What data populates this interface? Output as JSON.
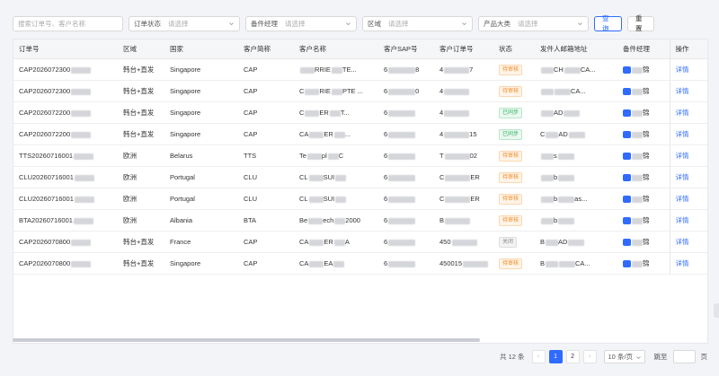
{
  "filters": {
    "search_placeholder": "搜索订单号、客户名称",
    "selects": [
      {
        "label": "订单状态",
        "placeholder": "请选择"
      },
      {
        "label": "备件经理",
        "placeholder": "请选择"
      },
      {
        "label": "区域",
        "placeholder": "请选择"
      },
      {
        "label": "产品大类",
        "placeholder": "请选择"
      }
    ],
    "query_label": "查询",
    "reset_label": "重置"
  },
  "table": {
    "columns": [
      "订单号",
      "区域",
      "国家",
      "客户简称",
      "客户名称",
      "客户SAP号",
      "客户订单号",
      "状态",
      "发件人邮箱地址",
      "备件经理",
      "操作"
    ],
    "rows": [
      {
        "order": "CAP2026072300",
        "region": "韩台+直发",
        "country": "Singapore",
        "abbr": "CAP",
        "name_a": "",
        "name_b": "RRIE",
        "name_c": "TE...",
        "sap_a": "6",
        "sap_b": "8",
        "cust_a": "4",
        "cust_b": "7",
        "status": "待审核",
        "email_a": "",
        "email_b": "CH",
        "email_c": "CA...",
        "mgr": "锦",
        "action": "详情"
      },
      {
        "order": "CAP2026072300",
        "region": "韩台+直发",
        "country": "Singapore",
        "abbr": "CAP",
        "name_a": "C",
        "name_b": "RIE",
        "name_c": "PTE ...",
        "sap_a": "6",
        "sap_b": "0",
        "cust_a": "4",
        "cust_b": "",
        "status": "待审核",
        "email_a": "",
        "email_b": "",
        "email_c": "CA...",
        "mgr": "锦",
        "action": "详情"
      },
      {
        "order": "CAP2026072200",
        "region": "韩台+直发",
        "country": "Singapore",
        "abbr": "CAP",
        "name_a": "C",
        "name_b": "ER",
        "name_c": "T...",
        "sap_a": "6",
        "sap_b": "",
        "cust_a": "4",
        "cust_b": "",
        "status": "已同步",
        "email_a": "",
        "email_b": "AD",
        "email_c": "",
        "mgr": "锦",
        "action": "详情"
      },
      {
        "order": "CAP2026072200",
        "region": "韩台+直发",
        "country": "Singapore",
        "abbr": "CAP",
        "name_a": "CA",
        "name_b": "ER",
        "name_c": "...",
        "sap_a": "6",
        "sap_b": "",
        "cust_a": "4",
        "cust_b": "15",
        "status": "已同步",
        "email_a": "C",
        "email_b": "AD",
        "email_c": "",
        "mgr": "锦",
        "action": "详情"
      },
      {
        "order": "TTS20260716001",
        "region": "欧洲",
        "country": "Belarus",
        "abbr": "TTS",
        "name_a": "Te",
        "name_b": "pl",
        "name_c": "C",
        "sap_a": "6",
        "sap_b": "",
        "cust_a": "T",
        "cust_b": "02",
        "status": "待审核",
        "email_a": "",
        "email_b": "s",
        "email_c": "",
        "mgr": "锦",
        "action": "详情"
      },
      {
        "order": "CLU20260716001",
        "region": "欧洲",
        "country": "Portugal",
        "abbr": "CLU",
        "name_a": "CL",
        "name_b": "SUI",
        "name_c": "",
        "sap_a": "6",
        "sap_b": "",
        "cust_a": "C",
        "cust_b": "ER",
        "status": "待审核",
        "email_a": "",
        "email_b": "b",
        "email_c": "",
        "mgr": "锦",
        "action": "详情"
      },
      {
        "order": "CLU20260716001",
        "region": "欧洲",
        "country": "Portugal",
        "abbr": "CLU",
        "name_a": "CL",
        "name_b": "SUI",
        "name_c": "",
        "sap_a": "6",
        "sap_b": "",
        "cust_a": "C",
        "cust_b": "ER",
        "status": "待审核",
        "email_a": "",
        "email_b": "b",
        "email_c": "as...",
        "mgr": "锦",
        "action": "详情"
      },
      {
        "order": "BTA20260716001",
        "region": "欧洲",
        "country": "Albania",
        "abbr": "BTA",
        "name_a": "Be",
        "name_b": "ech",
        "name_c": "2000",
        "sap_a": "6",
        "sap_b": "",
        "cust_a": "B",
        "cust_b": "",
        "status": "待审核",
        "email_a": "",
        "email_b": "b",
        "email_c": "",
        "mgr": "锦",
        "action": "详情"
      },
      {
        "order": "CAP2026070800",
        "region": "韩台+直发",
        "country": "France",
        "abbr": "CAP",
        "name_a": "CA",
        "name_b": "ER",
        "name_c": "A",
        "sap_a": "6",
        "sap_b": "",
        "cust_a": "450",
        "cust_b": "",
        "status": "关闭",
        "email_a": "B",
        "email_b": "AD",
        "email_c": "",
        "mgr": "锦",
        "action": "详情"
      },
      {
        "order": "CAP2026070800",
        "region": "韩台+直发",
        "country": "Singapore",
        "abbr": "CAP",
        "name_a": "CA",
        "name_b": "EA",
        "name_c": "",
        "sap_a": "6",
        "sap_b": "",
        "cust_a": "450015",
        "cust_b": "",
        "status": "待审核",
        "email_a": "B",
        "email_b": "",
        "email_c": "CA...",
        "mgr": "锦",
        "action": "详情"
      }
    ]
  },
  "pagination": {
    "total": "共 12 条",
    "prev": "‹",
    "pages": [
      "1",
      "2"
    ],
    "next": "›",
    "page_size": "10 条/页",
    "jump_label": "跳至",
    "page_suffix": "页"
  },
  "colors": {
    "primary": "#2f6bff",
    "pending": "#f08a24",
    "synced": "#34b36b"
  }
}
